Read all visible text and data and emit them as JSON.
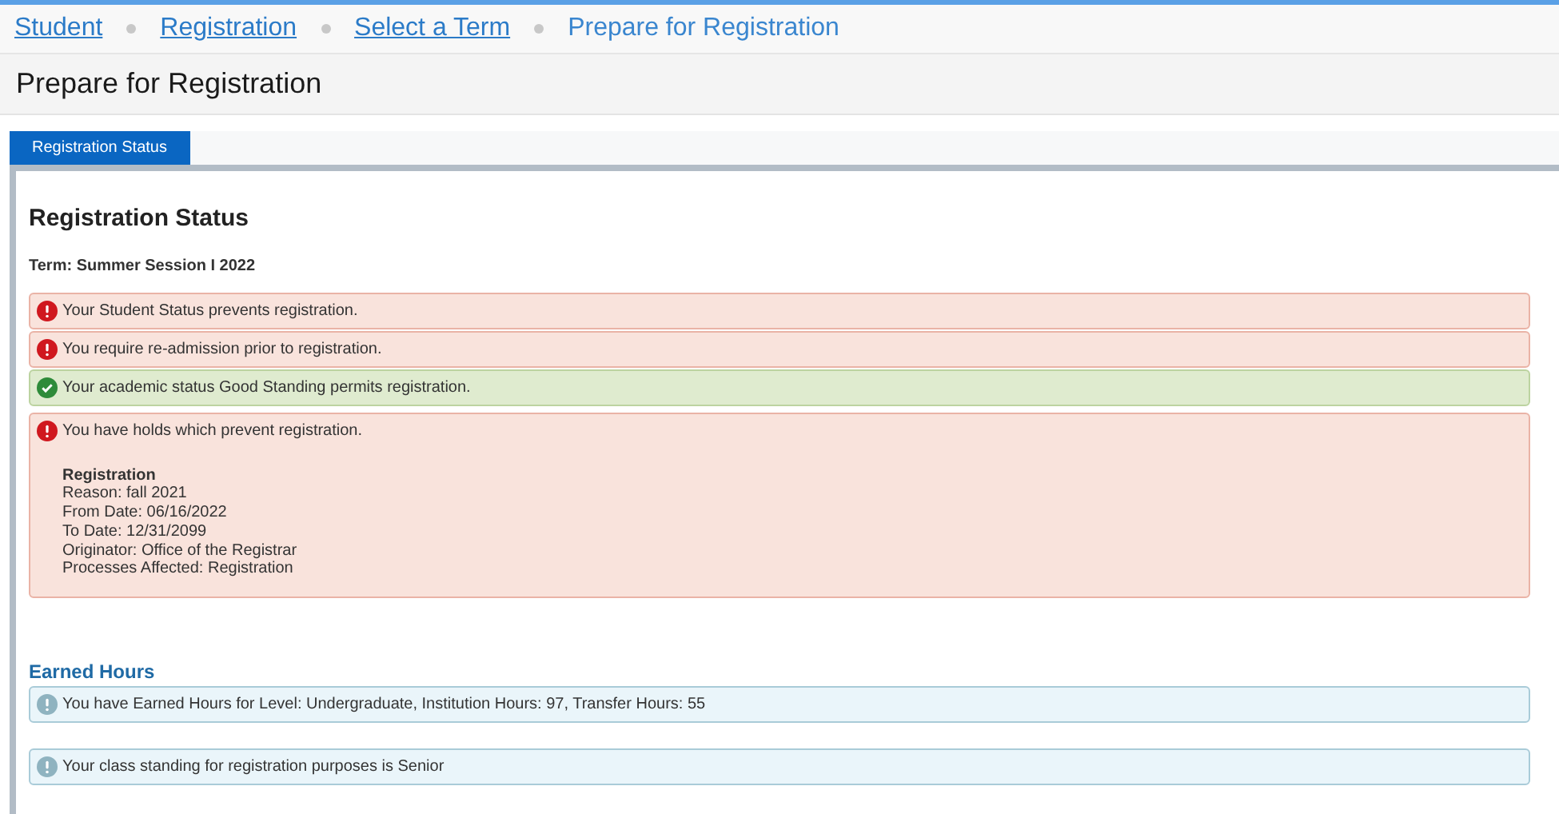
{
  "breadcrumbs": [
    {
      "label": "Student",
      "link": true
    },
    {
      "label": "Registration",
      "link": true
    },
    {
      "label": "Select a Term",
      "link": true
    },
    {
      "label": "Prepare for Registration",
      "link": false
    }
  ],
  "page_title": "Prepare for Registration",
  "tabs": [
    {
      "label": "Registration Status",
      "selected": true
    }
  ],
  "section_title": "Registration Status",
  "term": "Term: Summer Session I 2022",
  "status_messages": [
    {
      "kind": "error",
      "text": "Your Student Status prevents registration."
    },
    {
      "kind": "error",
      "text": "You require re-admission prior to registration."
    },
    {
      "kind": "success",
      "text": "Your academic status Good Standing permits registration."
    },
    {
      "kind": "error",
      "text": "You have holds which prevent registration.",
      "detail_title": "Registration",
      "details": [
        "Reason: fall 2021",
        "From Date: 06/16/2022",
        "To Date: 12/31/2099",
        "Originator: Office of the Registrar",
        "Processes Affected: Registration"
      ]
    }
  ],
  "earned_hours": {
    "title": "Earned Hours",
    "messages": [
      {
        "kind": "info",
        "text": "You have Earned Hours for Level: Undergraduate, Institution Hours: 97, Transfer Hours: 55"
      },
      {
        "kind": "info",
        "text": "Your class standing for registration purposes is Senior"
      }
    ]
  }
}
